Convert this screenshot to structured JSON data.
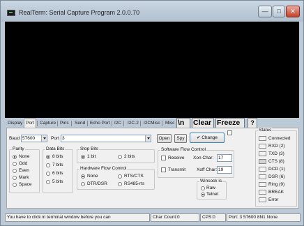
{
  "window": {
    "title": "RealTerm: Serial Capture Program 2.0.0.70",
    "minimize_glyph": "—",
    "maximize_glyph": "□",
    "close_glyph": "✕"
  },
  "tabs": [
    "Display",
    "Port",
    "Capture",
    "Pins",
    "Send",
    "Echo Port",
    "I2C",
    "I2C-2",
    "I2CMisc",
    "Misc"
  ],
  "active_tab": "Port",
  "big_buttons": {
    "newline": "\\n",
    "clear": "Clear",
    "freeze": "Freeze",
    "help": "?"
  },
  "port": {
    "baud_label": "Baud",
    "baud_value": "57600",
    "port_label": "Port",
    "port_value": "3",
    "open_label": "Open",
    "spy_label": "Spy",
    "change_label": "Change",
    "parity": {
      "title": "Parity",
      "options": [
        "None",
        "Odd",
        "Even",
        "Mark",
        "Space"
      ],
      "selected": "None"
    },
    "data_bits": {
      "title": "Data Bits",
      "options": [
        "8 bits",
        "7 bits",
        "6 bits",
        "5 bits"
      ],
      "selected": "8 bits"
    },
    "stop_bits": {
      "title": "Stop Bits",
      "options": [
        "1 bit",
        "2 bits"
      ],
      "selected": "1 bit"
    },
    "hardware_flow": {
      "title": "Hardware Flow Control",
      "options": [
        "None",
        "RTS/CTS",
        "DTR/DSR",
        "RS485-rts"
      ],
      "selected": "None"
    },
    "software_flow": {
      "title": "Software Flow Control",
      "receive_label": "Receive",
      "transmit_label": "Transmit",
      "xon_label": "Xon Char:",
      "xon_value": "17",
      "xoff_label": "Xoff Char:",
      "xoff_value": "19"
    },
    "winsock": {
      "title": "Winsock is",
      "options": [
        "Raw",
        "Telnet"
      ],
      "selected": "Telnet"
    }
  },
  "status": {
    "title": "Status",
    "items": [
      "Connected",
      "RXD (2)",
      "TXD (3)",
      "CTS (8)",
      "DCD (1)",
      "DSR (6)",
      "Ring (9)",
      "BREAK",
      "Error"
    ]
  },
  "statusbar": {
    "message": "You have to click in terminal window before you can",
    "char_count": "Char Count:0",
    "cps": "CPS:0",
    "port_status": "Port: 3 57600 8N1 None"
  }
}
